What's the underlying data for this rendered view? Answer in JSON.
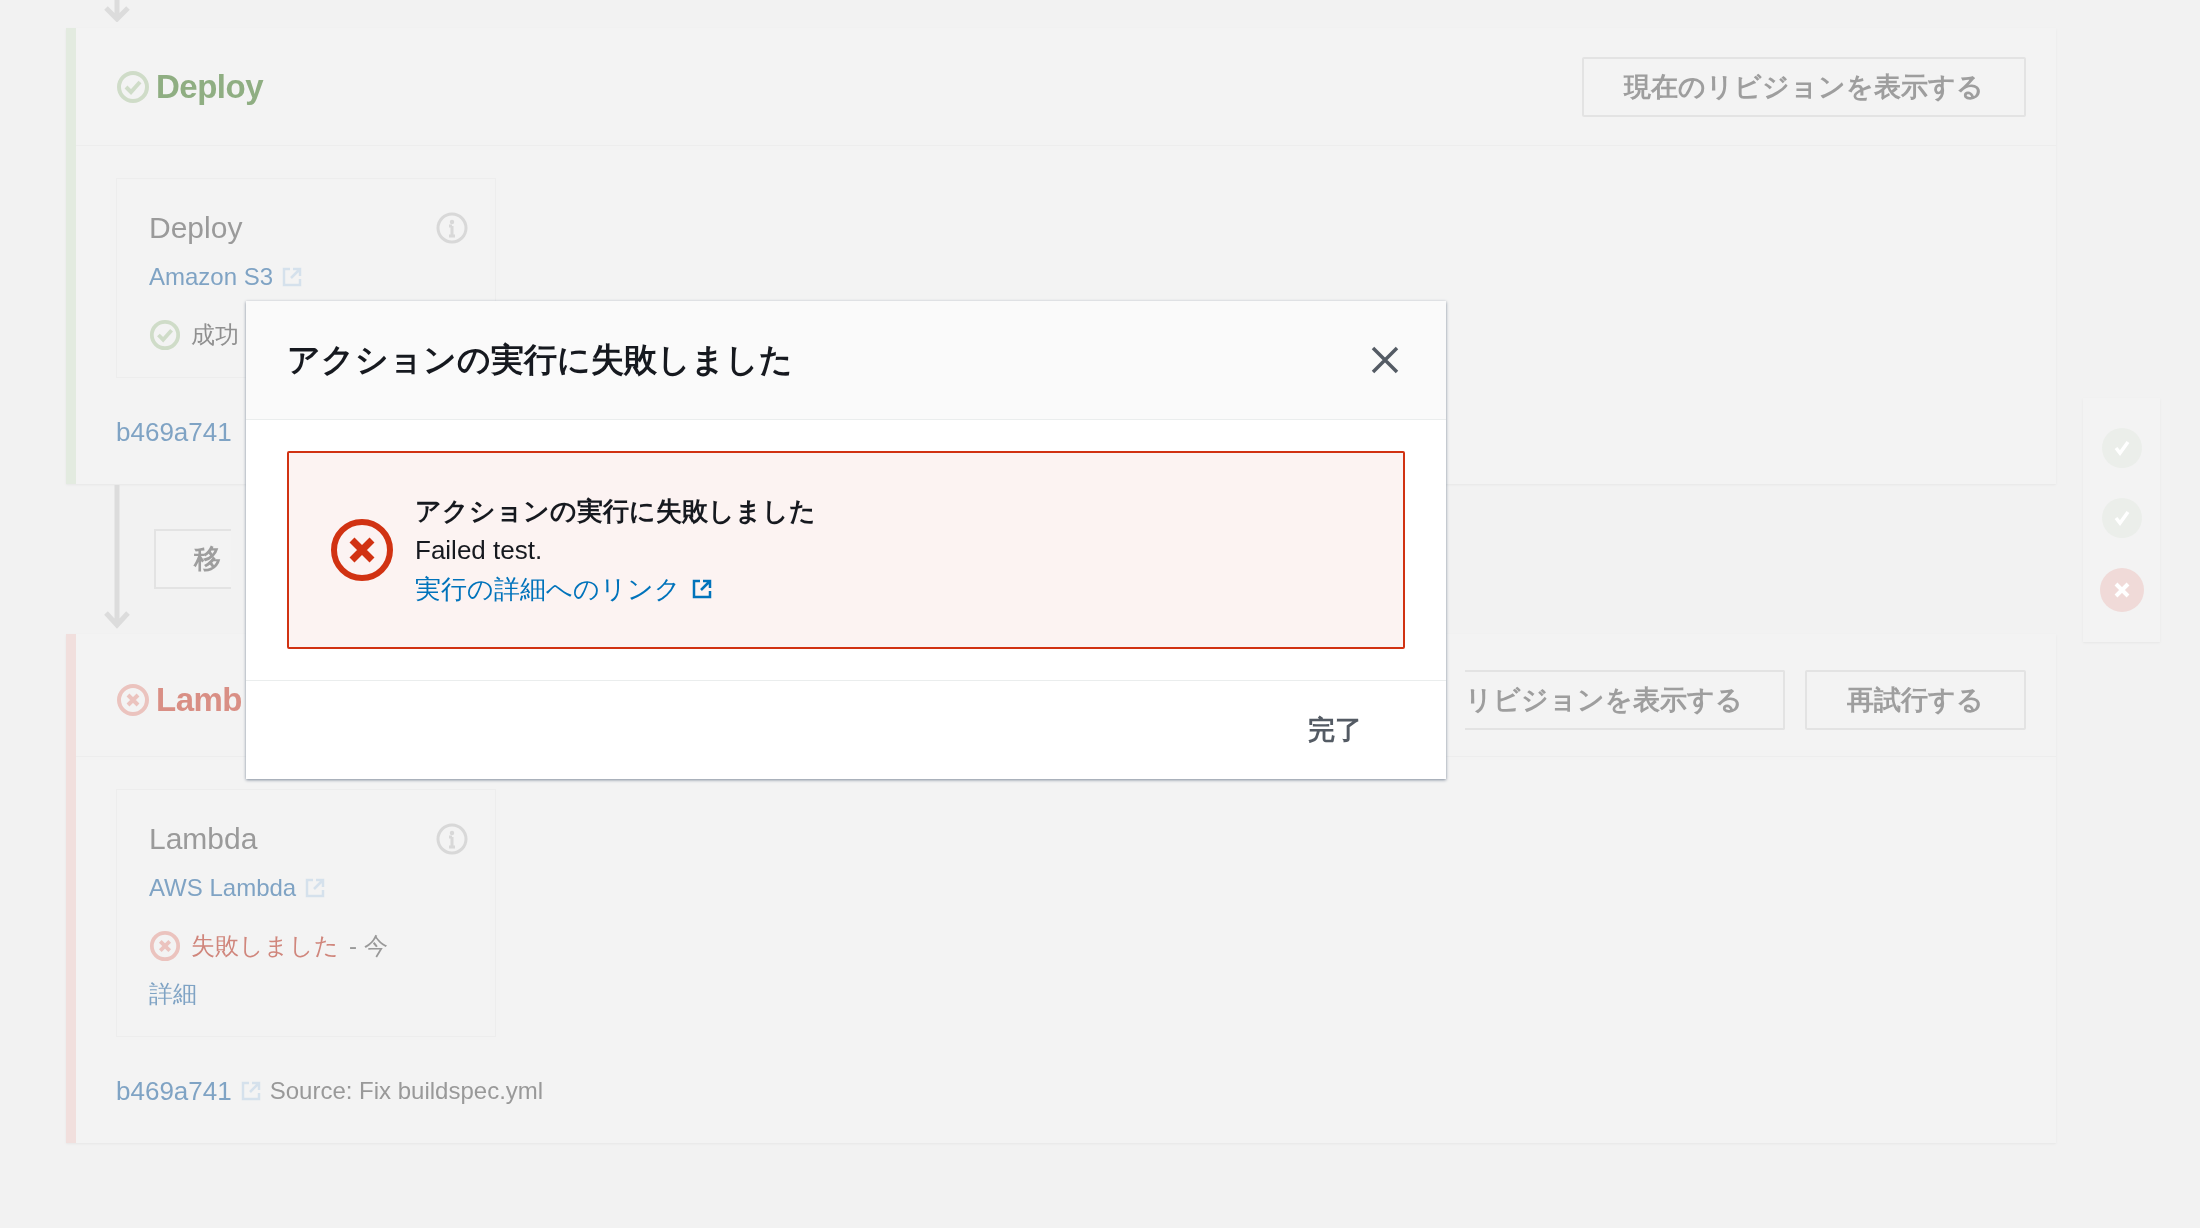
{
  "pipeline": {
    "stages": [
      {
        "name": "Deploy",
        "kind": "succeeded",
        "buttons": [
          "現在のリビジョンを表示する"
        ],
        "action": {
          "name": "Deploy",
          "provider": "Amazon S3",
          "kind": "succeeded",
          "status_text": "成功"
        },
        "revision": {
          "id": "b469a741"
        }
      },
      {
        "name": "Lamb",
        "kind": "failed",
        "buttons": [
          "リビジョンを表示する",
          "再試行する"
        ],
        "action": {
          "name": "Lambda",
          "provider": "AWS Lambda",
          "kind": "failed",
          "status_text": "失敗しました",
          "time": "- 今",
          "details_link": "詳細"
        },
        "revision": {
          "id": "b469a741",
          "source": "Source: Fix buildspec.yml"
        }
      }
    ],
    "transition_button": "移",
    "stage_summary": [
      {
        "kind": "succeeded"
      },
      {
        "kind": "succeeded"
      },
      {
        "kind": "failed"
      }
    ]
  },
  "dialog": {
    "title": "アクションの実行に失敗しました",
    "alert": {
      "kind": "error",
      "title": "アクションの実行に失敗しました",
      "message": "Failed test.",
      "link": "実行の詳細へのリンク"
    },
    "buttons": [
      "完了"
    ]
  }
}
